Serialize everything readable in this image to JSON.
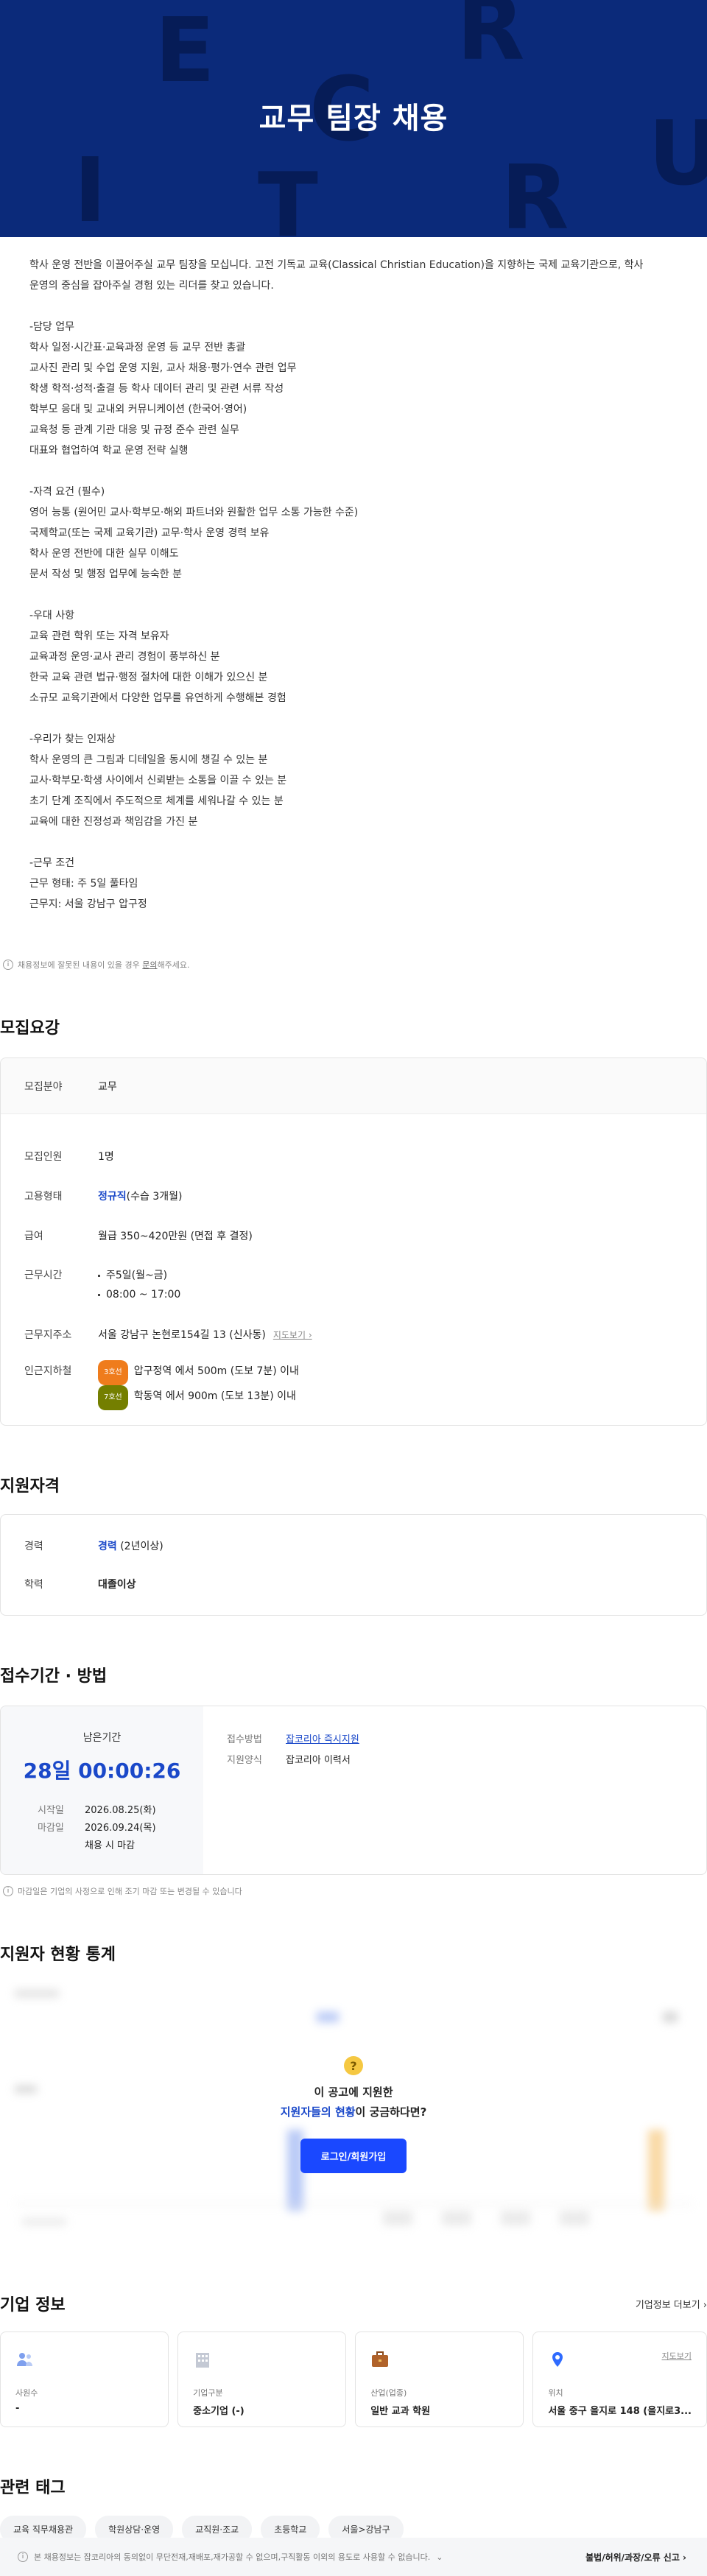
{
  "banner": {
    "title": "교무 팀장 채용",
    "letters": [
      "E",
      "R",
      "U",
      "C",
      "I",
      "T",
      "R"
    ]
  },
  "description": [
    "학사 운영 전반을 이끌어주실 교무 팀장을 모십니다. 고전 기독교 교육(Classical Christian Education)을 지향하는 국제 교육기관으로, 학사",
    "운영의 중심을 잡아주실 경험 있는 리더를 찾고 있습니다.",
    "",
    "-담당 업무",
    "학사 일정·시간표·교육과정 운영 등 교무 전반 총괄",
    "교사진 관리 및 수업 운영 지원, 교사 채용·평가·연수 관련 업무",
    "학생 학적·성적·출결 등 학사 데이터 관리 및 관련 서류 작성",
    "학부모 응대 및 교내외 커뮤니케이션 (한국어·영어)",
    "교육청 등 관계 기관 대응 및 규정 준수 관련 실무",
    "대표와 협업하여 학교 운영 전략 실행",
    "",
    "-자격 요건 (필수)",
    "영어 능통 (원어민 교사·학부모·해외 파트너와 원활한 업무 소통 가능한 수준)",
    "국제학교(또는 국제 교육기관) 교무·학사 운영 경력 보유",
    "학사 운영 전반에 대한 실무 이해도",
    "문서 작성 및 행정 업무에 능숙한 분",
    "",
    "-우대 사항",
    "교육 관련 학위 또는 자격 보유자",
    "교육과정 운영·교사 관리 경험이 풍부하신 분",
    "한국 교육 관련 법규·행정 절차에 대한 이해가 있으신 분",
    "소규모 교육기관에서 다양한 업무를 유연하게 수행해본 경험",
    "",
    "-우리가 찾는 인재상",
    "학사 운영의 큰 그림과 디테일을 동시에 챙길 수 있는 분",
    "교사·학부모·학생 사이에서 신뢰받는 소통을 이끌 수 있는 분",
    "초기 단계 조직에서 주도적으로 체계를 세워나갈 수 있는 분",
    "교육에 대한 진정성과 책임감을 가진 분",
    "",
    "-근무 조건",
    "근무 형태: 주 5일 풀타임",
    "근무지: 서울 강남구 압구정"
  ],
  "report": {
    "prefix": "채용정보에 잘못된 내용이 있을 경우 ",
    "link": "문의",
    "suffix": "해주세요."
  },
  "requirements": {
    "title": "모집요강",
    "field_label": "모집분야",
    "field_value": "교무",
    "headcount_label": "모집인원",
    "headcount_value": "1명",
    "employment_label": "고용형태",
    "employment_value": "정규직",
    "employment_note": "(수습 3개월)",
    "salary_label": "급여",
    "salary_value": "월급 350~420만원 (면접 후 결정)",
    "hours_label": "근무시간",
    "hours": [
      "주5일(월~금)",
      "08:00 ~ 17:00"
    ],
    "address_label": "근무지주소",
    "address_value": "서울 강남구 논현로154길 13 (신사동)",
    "map_link": "지도보기",
    "subway_label": "인근지하철",
    "subway": [
      {
        "line": "3호선",
        "color": "#ef7c1c",
        "text": "압구정역 에서 500m (도보 7분) 이내"
      },
      {
        "line": "7호선",
        "color": "#747f00",
        "text": "학동역 에서 900m (도보 13분) 이내"
      }
    ]
  },
  "qualifications": {
    "title": "지원자격",
    "career_label": "경력",
    "career_value": "경력",
    "career_note": "(2년이상)",
    "edu_label": "학력",
    "edu_value": "대졸이상"
  },
  "period": {
    "title": "접수기간 · 방법",
    "remain_label": "남은기간",
    "remain_value": "28일 00:00:26",
    "start_label": "시작일",
    "start_value": "2026.08.25(화)",
    "end_label": "마감일",
    "end_value": "2026.09.24(목)",
    "end_note": "채용 시 마감",
    "method_label": "접수방법",
    "method_value": "잡코리아 즉시지원",
    "form_label": "지원양식",
    "form_value": "잡코리아 이력서",
    "note": "마감일은 기업의 사정으로 인해 조기 마감 또는 변경될 수 있습니다"
  },
  "stats": {
    "title": "지원자 현황 통계",
    "line1": "이 공고에 지원한",
    "line2_highlight": "지원자들의 현황",
    "line2_rest": "이 궁금하다면?",
    "button": "로그인/회원가입"
  },
  "company": {
    "title": "기업 정보",
    "more": "기업정보 더보기 ›",
    "tiles": [
      {
        "label": "사원수",
        "value": "-",
        "icon": "people-icon"
      },
      {
        "label": "기업구분",
        "value": "중소기업 (-)",
        "icon": "building-icon"
      },
      {
        "label": "산업(업종)",
        "value": "일반 교과 학원",
        "icon": "briefcase-icon"
      },
      {
        "label": "위치",
        "value": "서울 중구 을지로 148 (을지로3...",
        "icon": "location-pin-icon",
        "link": "지도보기"
      }
    ]
  },
  "tags": {
    "title": "관련 태그",
    "items": [
      "교육 직무채용관",
      "학원상담·운영",
      "교직원·조교",
      "초등학교",
      "서울>강남구"
    ]
  },
  "footer": {
    "notice": "본 채용정보는 잡코리아의 동의없이 무단전재,재배포,재가공할 수 없으며,구직활동 이외의 용도로 사용할 수 없습니다.",
    "report": "불법/허위/과장/오류 신고 ›"
  },
  "colors": {
    "banner": "#0b2a7a",
    "accent": "#1a48c9",
    "button": "#1a48ff"
  }
}
